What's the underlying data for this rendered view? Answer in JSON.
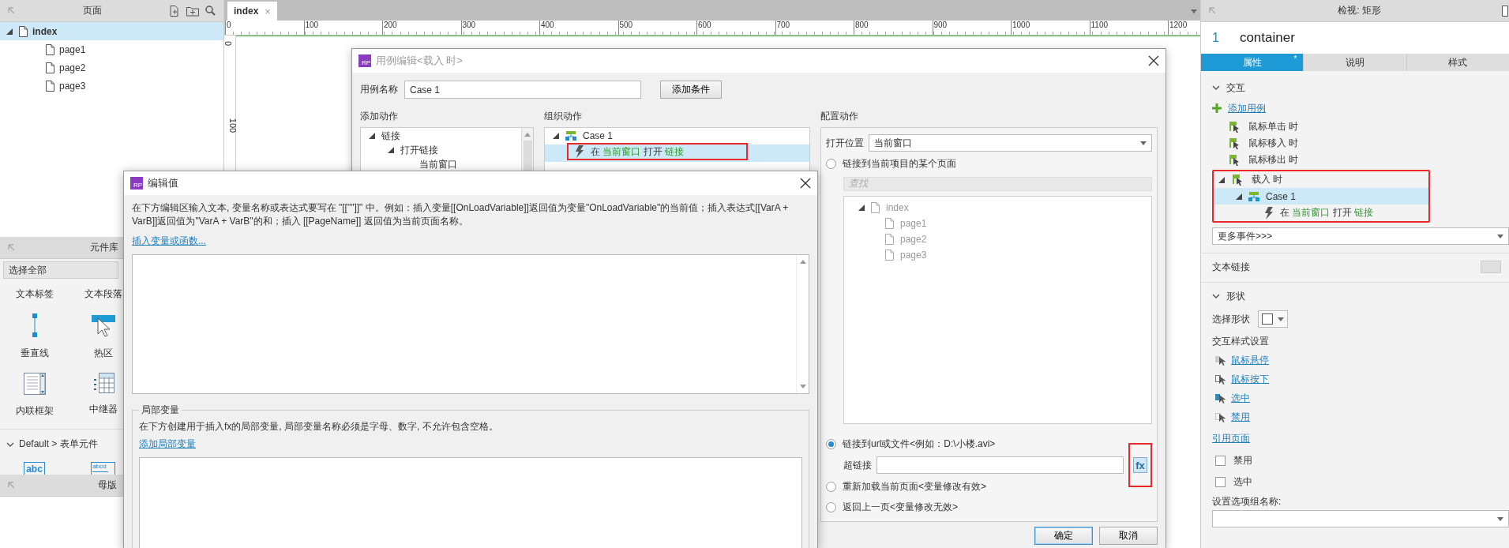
{
  "pages_panel": {
    "title": "页面",
    "tree": [
      {
        "label": "index",
        "selected": true,
        "expanded": true,
        "children": [
          {
            "label": "page1",
            "selected": false
          },
          {
            "label": "page2",
            "selected": false
          },
          {
            "label": "page3",
            "selected": false
          }
        ]
      }
    ]
  },
  "library_panel": {
    "title": "元件库",
    "filter": "选择全部",
    "widgets": [
      {
        "kind": "label",
        "label": "文本标签"
      },
      {
        "kind": "label",
        "label": "文本段落"
      },
      {
        "kind": "vertical-line",
        "label": "垂直线"
      },
      {
        "kind": "hotspot",
        "label": "热区"
      },
      {
        "kind": "iframe",
        "label": "内联框架"
      },
      {
        "kind": "repeater",
        "label": "中继器"
      }
    ],
    "group": {
      "label": "Default > 表单元件",
      "expanded": true,
      "widgets": [
        {
          "kind": "text-field",
          "glyph": "abc"
        },
        {
          "kind": "text-area",
          "glyph": "abcd"
        }
      ]
    }
  },
  "masters_panel": {
    "title": "母版"
  },
  "document_tabs": [
    {
      "label": "index",
      "close": "×",
      "selected": true
    }
  ],
  "ruler": {
    "x_marks": [
      "0",
      "100",
      "200",
      "300",
      "400",
      "500",
      "600",
      "700",
      "800",
      "900",
      "1000",
      "1100",
      "1200"
    ],
    "y_marks": [
      "0",
      "100"
    ]
  },
  "case_editor": {
    "logo": "RP",
    "title": "用例编辑<载入 时>",
    "name_label": "用例名称",
    "name_value": "Case 1",
    "add_condition": "添加条件",
    "add_actions": {
      "title": "添加动作",
      "tree": [
        {
          "label": "链接",
          "expanded": true,
          "children": [
            {
              "label": "打开链接",
              "expanded": true,
              "children": [
                {
                  "label": "当前窗口"
                }
              ]
            }
          ]
        }
      ]
    },
    "organize_actions": {
      "title": "组织动作",
      "cases": [
        {
          "label": "Case 1",
          "expanded": true,
          "actions": [
            {
              "selected": true,
              "highlighted": true,
              "parts": [
                {
                  "kind": "plain",
                  "text": "在"
                },
                {
                  "kind": "param",
                  "text": "当前窗口"
                },
                {
                  "kind": "plain",
                  "text": "打开"
                },
                {
                  "kind": "param",
                  "text": "链接"
                }
              ]
            }
          ]
        }
      ]
    },
    "configure_actions": {
      "title": "配置动作",
      "open_in_label": "打开位置",
      "open_in_value": "当前窗口",
      "options": [
        {
          "kind": "page",
          "label": "链接到当前项目的某个页面",
          "selected": false,
          "search_placeholder": "查找",
          "tree": [
            {
              "label": "index",
              "expanded": true,
              "children": [
                {
                  "label": "page1"
                },
                {
                  "label": "page2"
                },
                {
                  "label": "page3"
                }
              ]
            }
          ]
        },
        {
          "kind": "url",
          "label": "链接到url或文件<例如：D:\\小楼.avi>",
          "selected": true,
          "field_label": "超链接",
          "fx": "fx",
          "fx_highlighted": true
        },
        {
          "kind": "plain",
          "label": "重新加载当前页面<变量修改有效>",
          "selected": false
        },
        {
          "kind": "plain",
          "label": "返回上一页<变量修改无效>",
          "selected": false
        }
      ]
    },
    "buttons": [
      {
        "label": "确定",
        "default": true
      },
      {
        "label": "取消",
        "default": false
      }
    ]
  },
  "edit_value_dialog": {
    "logo": "RP",
    "title": "编辑值",
    "description": "在下方编辑区输入文本, 变量名称或表达式要写在 \"[[\"\"]]\" 中。例如：插入变量[[OnLoadVariable]]返回值为变量\"OnLoadVariable\"的当前值；插入表达式[[VarA + VarB]]返回值为\"VarA + VarB\"的和；插入 [[PageName]] 返回值为当前页面名称。",
    "insert_link": "插入变量或函数...",
    "local_vars": {
      "legend": "局部变量",
      "hint": "在下方创建用于插入fx的局部变量, 局部变量名称必须是字母、数字, 不允许包含空格。",
      "add_link": "添加局部变量"
    }
  },
  "inspector": {
    "title": "检视: 矩形",
    "index": "1",
    "name": "container",
    "tabs": [
      {
        "label": "属性",
        "selected": true,
        "badge": "*"
      },
      {
        "label": "说明",
        "selected": false
      },
      {
        "label": "样式",
        "selected": false
      }
    ],
    "interaction": {
      "title": "交互",
      "expanded": true,
      "add_case": "添加用例",
      "events": [
        {
          "label": "鼠标单击 时",
          "expanded": false,
          "highlighted": false
        },
        {
          "label": "鼠标移入 时",
          "expanded": false,
          "highlighted": false
        },
        {
          "label": "鼠标移出 时",
          "expanded": false,
          "highlighted": false
        },
        {
          "label": "载入 时",
          "expanded": true,
          "highlighted": true,
          "cases": [
            {
              "label": "Case 1",
              "selected": true,
              "expanded": true,
              "actions": [
                {
                  "parts": [
                    {
                      "kind": "plain",
                      "text": "在"
                    },
                    {
                      "kind": "param",
                      "text": "当前窗口"
                    },
                    {
                      "kind": "plain",
                      "text": "打开"
                    },
                    {
                      "kind": "param",
                      "text": "链接"
                    }
                  ]
                }
              ]
            }
          ]
        }
      ],
      "more_events": "更多事件>>>"
    },
    "text_link": {
      "label": "文本链接",
      "disabled": true
    },
    "shape": {
      "title": "形状",
      "expanded": true,
      "select_label": "选择形状",
      "style_title": "交互样式设置",
      "styles": [
        {
          "kind": "hover",
          "label": "鼠标悬停"
        },
        {
          "kind": "mousedown",
          "label": "鼠标按下"
        },
        {
          "kind": "selected",
          "label": "选中"
        },
        {
          "kind": "disabled",
          "label": "禁用"
        }
      ],
      "ref_page": "引用页面",
      "checkboxes": [
        {
          "label": "禁用",
          "checked": false
        },
        {
          "label": "选中",
          "checked": false
        }
      ],
      "group_label": "设置选项组名称:"
    }
  }
}
